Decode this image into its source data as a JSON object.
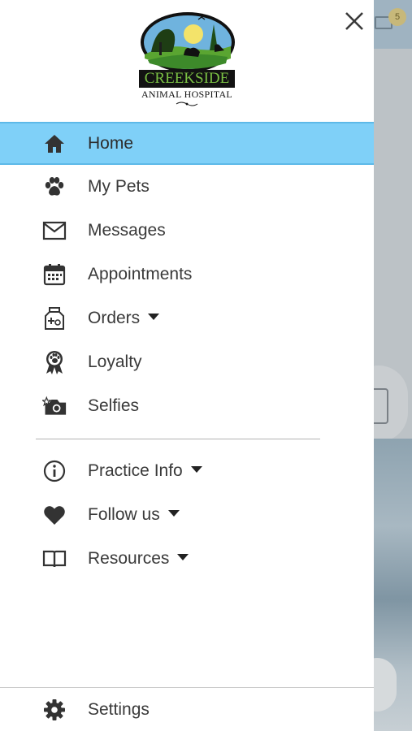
{
  "background": {
    "badge_count": "5"
  },
  "logo": {
    "name": "CREEKSIDE",
    "subtitle": "ANIMAL HOSPITAL"
  },
  "menu": {
    "items": [
      {
        "label": "Home",
        "icon": "home-icon"
      },
      {
        "label": "My Pets",
        "icon": "paw-icon"
      },
      {
        "label": "Messages",
        "icon": "envelope-icon"
      },
      {
        "label": "Appointments",
        "icon": "calendar-icon"
      },
      {
        "label": "Orders",
        "icon": "food-bag-icon"
      },
      {
        "label": "Loyalty",
        "icon": "award-ribbon-icon"
      },
      {
        "label": "Selfies",
        "icon": "camera-icon"
      }
    ],
    "secondary": [
      {
        "label": "Practice Info",
        "icon": "info-icon"
      },
      {
        "label": "Follow us",
        "icon": "heart-icon"
      },
      {
        "label": "Resources",
        "icon": "book-icon"
      }
    ],
    "settings_label": "Settings"
  },
  "colors": {
    "active_bg": "#7fd0f8",
    "text": "#3a3a3a",
    "logo_green": "#7ac043"
  }
}
